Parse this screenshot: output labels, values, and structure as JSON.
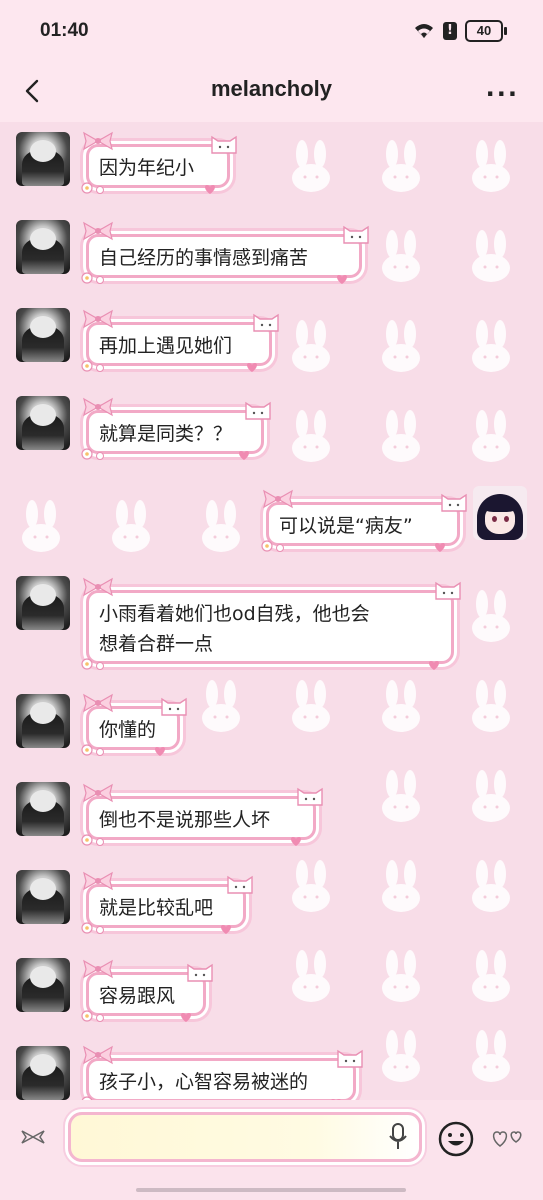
{
  "status_bar": {
    "time": "01:40",
    "battery": "40"
  },
  "header": {
    "title": "melancholy"
  },
  "messages": [
    {
      "side": "left",
      "text": "因为年纪小"
    },
    {
      "side": "left",
      "text": "自己经历的事情感到痛苦"
    },
    {
      "side": "left",
      "text": "再加上遇见她们"
    },
    {
      "side": "left",
      "text": "就算是同类？？"
    },
    {
      "side": "right",
      "text": "可以说是“病友”"
    },
    {
      "side": "left",
      "text": "小雨看着她们也od自残，他也会\n想着合群一点"
    },
    {
      "side": "left",
      "text": "你懂的"
    },
    {
      "side": "left",
      "text": "倒也不是说那些人坏"
    },
    {
      "side": "left",
      "text": "就是比较乱吧"
    },
    {
      "side": "left",
      "text": "容易跟风"
    },
    {
      "side": "left",
      "text": "孩子小，心智容易被迷的"
    }
  ],
  "colors": {
    "accent_pink": "#f2a9c6",
    "background": "#f8dde8",
    "bunny": "#ffffff"
  }
}
